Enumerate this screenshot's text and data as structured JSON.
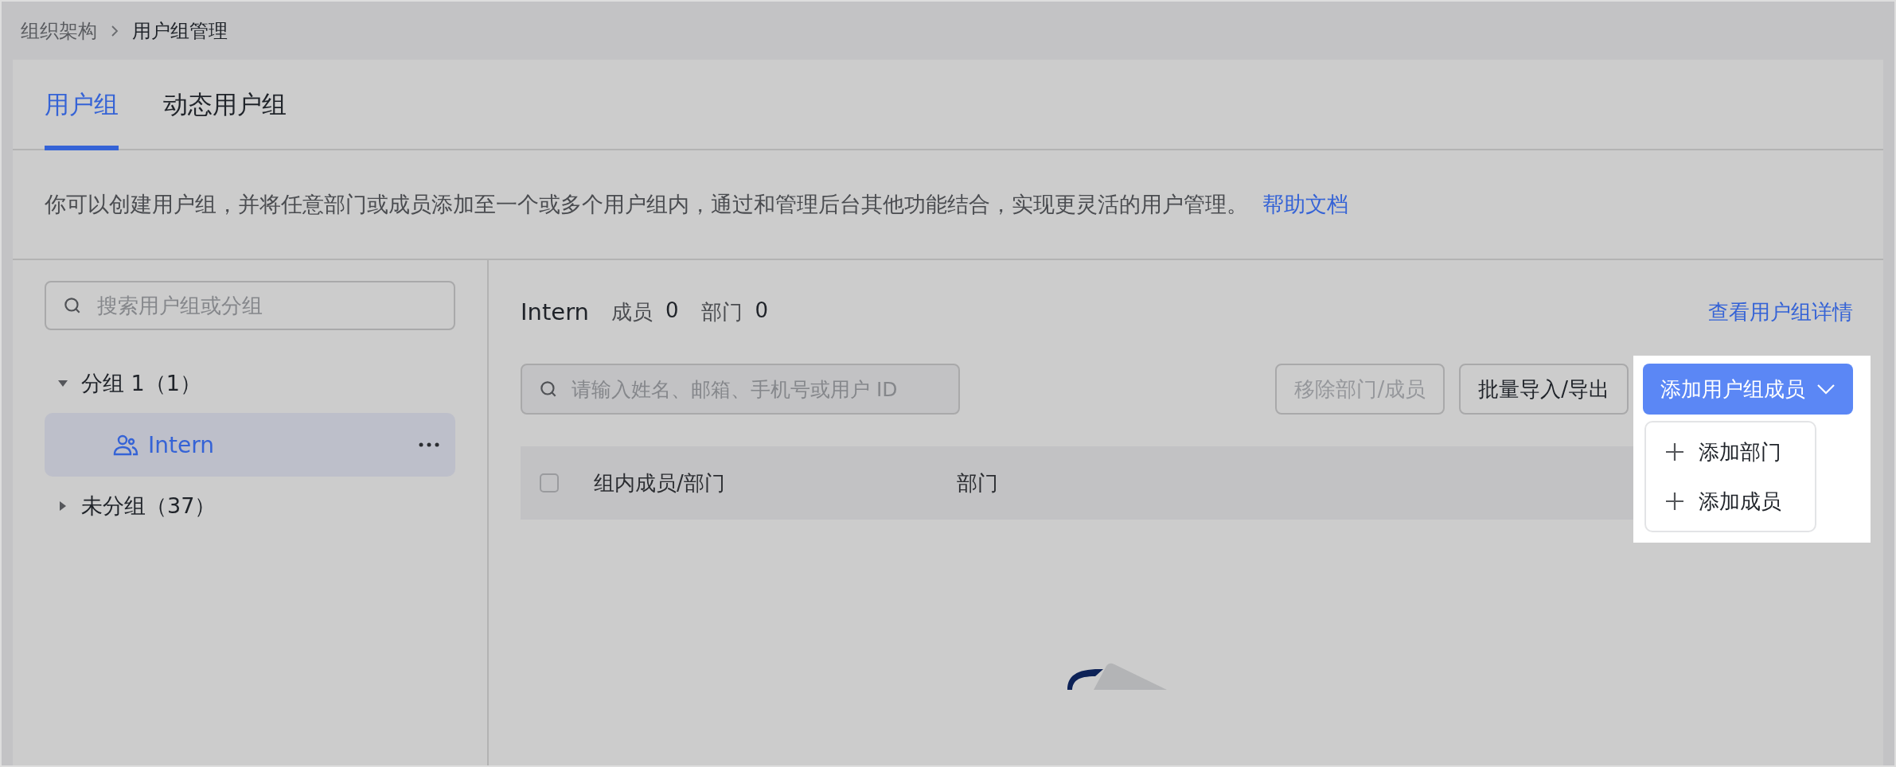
{
  "breadcrumb": [
    "组织架构",
    "用户组管理"
  ],
  "tabs": [
    {
      "label": "用户组",
      "selected": true
    },
    {
      "label": "动态用户组",
      "selected": false
    }
  ],
  "description": {
    "text": "你可以创建用户组，并将任意部门或成员添加至一个或多个用户组内，通过和管理后台其他功能结合，实现更灵活的用户管理。",
    "link": "帮助文档"
  },
  "sidebar": {
    "search_placeholder": "搜索用户组或分组",
    "groups": [
      {
        "label": "分组 1（1）",
        "expanded": true,
        "children": [
          {
            "label": "Intern",
            "selected": true
          }
        ]
      },
      {
        "label": "未分组（37）",
        "expanded": false
      }
    ]
  },
  "detail": {
    "title": "Intern",
    "stats": [
      {
        "label": "成员",
        "value": "0"
      },
      {
        "label": "部门",
        "value": "0"
      }
    ],
    "link": "查看用户组详情",
    "search_placeholder": "请输入姓名、邮箱、手机号或用户 ID",
    "buttons": [
      {
        "label": "移除部门/成员",
        "kind": "outline",
        "disabled": true
      },
      {
        "label": "批量导入/导出",
        "kind": "outline",
        "disabled": false
      },
      {
        "label": "添加用户组成员",
        "kind": "primary"
      }
    ],
    "dropdown": [
      "添加部门",
      "添加成员"
    ],
    "table": {
      "select_all_checked": false,
      "columns": [
        "组内成员/部门",
        "部门"
      ]
    }
  }
}
